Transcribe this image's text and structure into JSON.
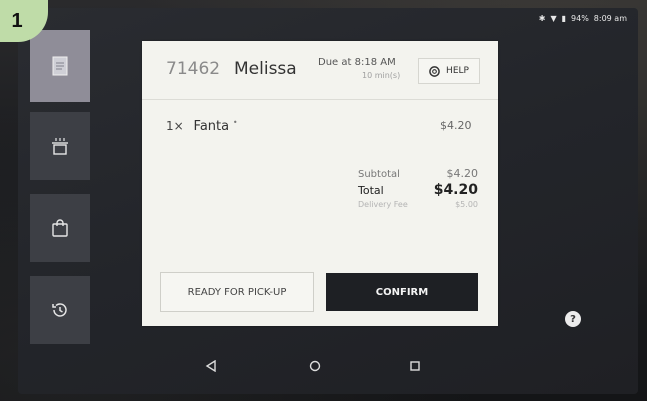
{
  "badge": "1",
  "status_bar": {
    "battery": "94%",
    "time": "8:09 am"
  },
  "side_nav": [
    {
      "icon": "receipt-icon",
      "active": true
    },
    {
      "icon": "food-tray-icon",
      "active": false
    },
    {
      "icon": "shopping-bag-icon",
      "active": false
    },
    {
      "icon": "history-icon",
      "active": false
    }
  ],
  "order": {
    "number": "71462",
    "customer": "Melissa",
    "due": "Due at 8:18 AM",
    "due_sub": "10 min(s)",
    "help_label": "HELP",
    "items": [
      {
        "qty": "1×",
        "name": "Fanta",
        "modifier": "•",
        "price": "$4.20"
      }
    ],
    "totals": {
      "subtotal_label": "Subtotal",
      "subtotal": "$4.20",
      "total_label": "Total",
      "total": "$4.20",
      "fee_label": "Delivery Fee",
      "fee": "$5.00"
    },
    "pickup_label": "READY FOR PICK-UP",
    "confirm_label": "CONFIRM"
  },
  "help_fab": "?",
  "android_nav": [
    "back-icon",
    "home-icon",
    "recents-icon"
  ]
}
